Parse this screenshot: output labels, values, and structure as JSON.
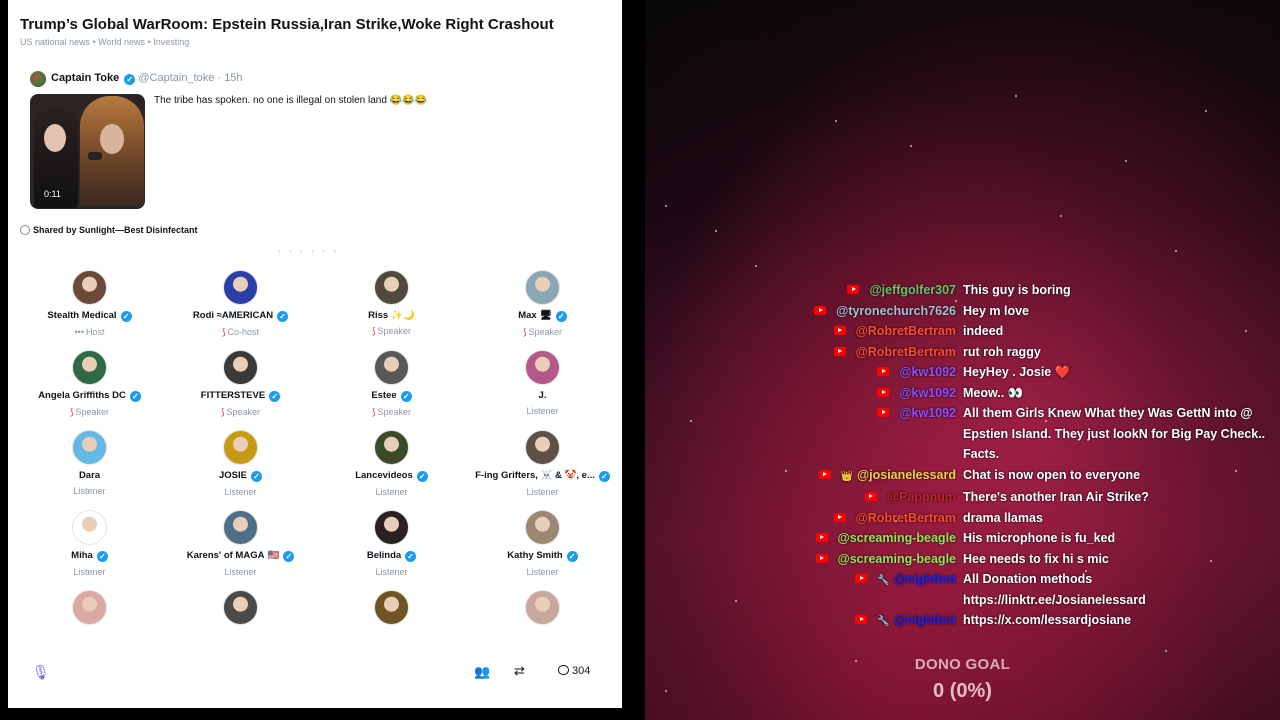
{
  "space": {
    "title": "Trump’s Global WarRoom: Epstein Russia,Iran Strike,Woke Right Crashout",
    "topics": "US national news • World news • Investing",
    "tweet": {
      "name": "Captain Toke",
      "handle": "@Captain_toke",
      "separator": "·",
      "time": "15h",
      "text": "The tribe has spoken. no one is illegal on stolen land 😂😂😂",
      "video_duration": "0:11"
    },
    "shared_by": "Shared by Sunlight—Best Disinfectant",
    "participants": [
      {
        "name": "Stealth Medical",
        "role": "Host",
        "verified": true,
        "avatar_color": "#6b4a3a",
        "role_icon": "•••"
      },
      {
        "name": "Rodi ≈AMERICAN",
        "role": "Co-host",
        "verified": true,
        "avatar_color": "#2b3fa8",
        "role_icon": "⟆"
      },
      {
        "name": "Riss",
        "suffix": "✨🌙",
        "role": "Speaker",
        "verified": false,
        "avatar_color": "#4e4a3c",
        "role_icon": "⟆"
      },
      {
        "name": "Max",
        "suffix": "🖥",
        "role": "Speaker",
        "verified": true,
        "avatar_color": "#8aa7b6",
        "role_icon": "⟆"
      },
      {
        "name": "Angela Griffiths DC",
        "role": "Speaker",
        "verified": true,
        "avatar_color": "#2f6a47",
        "role_icon": "⟆"
      },
      {
        "name": "FITTERSTEVE",
        "role": "Speaker",
        "verified": true,
        "avatar_color": "#3a3a3a",
        "role_icon": "⟆"
      },
      {
        "name": "Estee",
        "role": "Speaker",
        "verified": true,
        "avatar_color": "#585858",
        "role_icon": "⟆"
      },
      {
        "name": "J.",
        "role": "Listener",
        "verified": false,
        "avatar_color": "#b45a8a",
        "role_icon": ""
      },
      {
        "name": "Dara",
        "role": "Listener",
        "verified": false,
        "avatar_color": "#63b8e6",
        "role_icon": ""
      },
      {
        "name": "JOSIE",
        "role": "Listener",
        "verified": true,
        "avatar_color": "#c79a16",
        "role_icon": ""
      },
      {
        "name": "Lancevideos",
        "role": "Listener",
        "verified": true,
        "avatar_color": "#3d4a2a",
        "role_icon": ""
      },
      {
        "name": "F-ing Grifters, ☠️ & 🤡, e...",
        "role": "Listener",
        "verified": true,
        "avatar_color": "#5e5044",
        "role_icon": ""
      },
      {
        "name": "Miha",
        "role": "Listener",
        "verified": true,
        "avatar_color": "#ffffff",
        "role_icon": ""
      },
      {
        "name": "Karens' of MAGA",
        "suffix": "🇺🇸",
        "role": "Listener",
        "verified": true,
        "avatar_color": "#4d6f88",
        "role_icon": ""
      },
      {
        "name": "Belinda",
        "role": "Listener",
        "verified": true,
        "avatar_color": "#2a2220",
        "role_icon": ""
      },
      {
        "name": "Kathy Smith",
        "role": "Listener",
        "verified": true,
        "avatar_color": "#9c8872",
        "role_icon": ""
      },
      {
        "name": "",
        "role": "",
        "verified": false,
        "avatar_color": "#d9a9a2",
        "role_icon": ""
      },
      {
        "name": "",
        "role": "",
        "verified": false,
        "avatar_color": "#4a4a4a",
        "role_icon": ""
      },
      {
        "name": "",
        "role": "",
        "verified": false,
        "avatar_color": "#6e5426",
        "role_icon": ""
      },
      {
        "name": "",
        "role": "",
        "verified": false,
        "avatar_color": "#c9a79a",
        "role_icon": ""
      }
    ],
    "comment_count": "304"
  },
  "chat": {
    "messages": [
      {
        "user": "@jeffgolfer307",
        "color": "#6ec26e",
        "text": "This guy is boring",
        "badge": ""
      },
      {
        "user": "@tyronechurch7626",
        "color": "#a6c0d6",
        "text": "Hey m love",
        "badge": ""
      },
      {
        "user": "@RobretBertram",
        "color": "#ff4a2e",
        "text": "indeed",
        "badge": ""
      },
      {
        "user": "@RobretBertram",
        "color": "#ff4a2e",
        "text": "rut roh raggy",
        "badge": ""
      },
      {
        "user": "@kw1092",
        "color": "#8f4fff",
        "text": "HeyHey . Josie ❤️",
        "badge": ""
      },
      {
        "user": "@kw1092",
        "color": "#8f4fff",
        "text": "Meow.. 👀",
        "badge": ""
      },
      {
        "user": "@kw1092",
        "color": "#8f4fff",
        "text": "All them Girls Knew What they Was GettN into @ Epstien Island. They just lookN for Big Pay Check.. Facts.",
        "badge": ""
      },
      {
        "user": "@josianelessard",
        "color": "#f2d24b",
        "text": "Chat is now open to everyone",
        "badge": "👑"
      },
      {
        "user": "@Pappnum",
        "color": "#c8232d",
        "text": "There's another Iran Air Strike?",
        "badge": ""
      },
      {
        "user": "@RobretBertram",
        "color": "#ff4a2e",
        "text": "drama llamas",
        "badge": ""
      },
      {
        "user": "@screaming-beagle",
        "color": "#9be25a",
        "text": "His microphone is fu_ked",
        "badge": ""
      },
      {
        "user": "@screaming-beagle",
        "color": "#9be25a",
        "text": "Hee needs to fix hi s mic",
        "badge": ""
      },
      {
        "user": "@nightbot",
        "color": "#2222ee",
        "text": "All Donation methods https://linktr.ee/Josianelessard",
        "badge": "🔧"
      },
      {
        "user": "@nightbot",
        "color": "#2222ee",
        "text": "https://x.com/lessardjosiane",
        "badge": "🔧"
      }
    ]
  },
  "dono": {
    "label": "DONO GOAL",
    "value": "0 (0%)"
  }
}
